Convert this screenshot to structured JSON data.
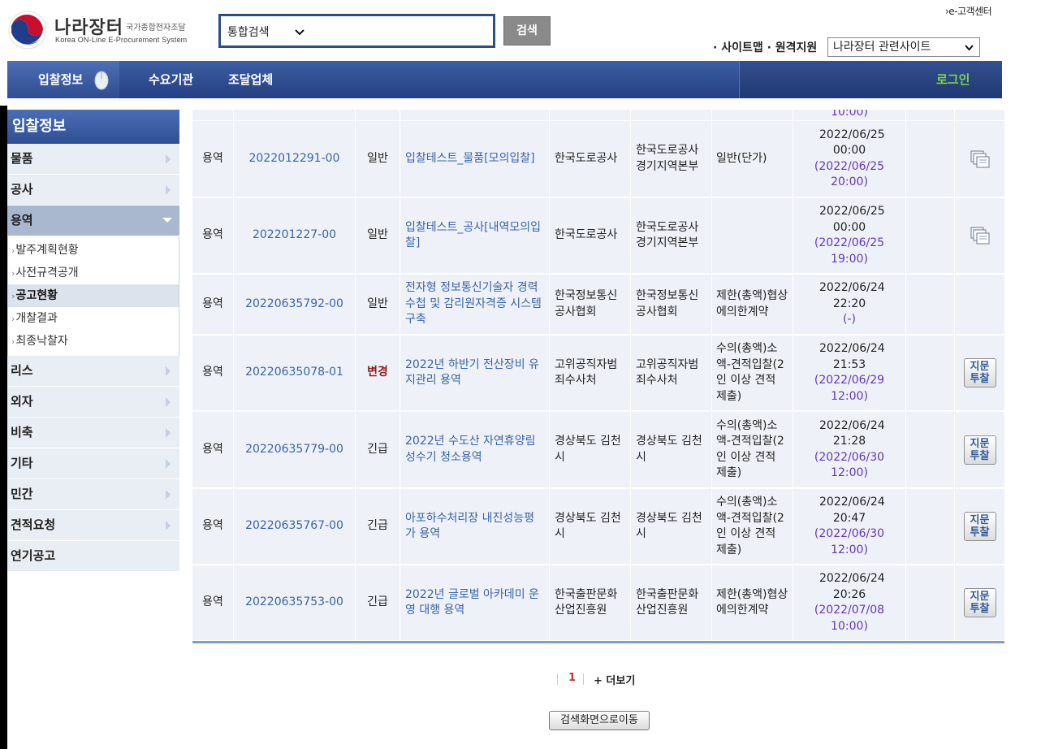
{
  "header": {
    "logo_title": "나라장터",
    "logo_subtitle": "국가종합전자조달",
    "logo_english": "Korea ON-Line E-Procurement System",
    "search_scope": "통합검색",
    "search_button": "검색",
    "customer_center": "›e-고객센터",
    "util_links": "· 사이트맵 · 원격지원",
    "related_sites": "나라장터 관련사이트"
  },
  "nav": {
    "items": [
      {
        "label": "입찰정보",
        "active": true
      },
      {
        "label": "수요기관"
      },
      {
        "label": "조달업체"
      }
    ],
    "login": "로그인"
  },
  "sidebar": {
    "title": "입찰정보",
    "items": [
      {
        "label": "물품"
      },
      {
        "label": "공사"
      },
      {
        "label": "용역",
        "open": true
      },
      {
        "label": "리스"
      },
      {
        "label": "외자"
      },
      {
        "label": "비축"
      },
      {
        "label": "기타"
      },
      {
        "label": "민간"
      },
      {
        "label": "견적요청"
      },
      {
        "label": "연기공고"
      }
    ],
    "sub_items": [
      {
        "label": "발주계획현황"
      },
      {
        "label": "사전규격공개"
      },
      {
        "label": "공고현황",
        "active": true
      },
      {
        "label": "개찰결과"
      },
      {
        "label": "최종낙찰자"
      }
    ]
  },
  "table": {
    "partial_top_text": "10:00)",
    "rows": [
      {
        "type": "용역",
        "no": "2022012291-00",
        "kind": "일반",
        "name": "입찰테스트_물품[모의입찰]",
        "org1": "한국도로공사",
        "org2": "한국도로공사 경기지역본부",
        "contract": "일반(단가)",
        "date": "2022/06/25 00:00",
        "deadline": "(2022/06/25 20:00)",
        "action": "copy"
      },
      {
        "type": "용역",
        "no": "202201227-00",
        "kind": "일반",
        "name": "입찰테스트_공사[내역모의입찰]",
        "org1": "한국도로공사",
        "org2": "한국도로공사 경기지역본부",
        "contract": "",
        "date": "2022/06/25 00:00",
        "deadline": "(2022/06/25 19:00)",
        "action": "copy"
      },
      {
        "type": "용역",
        "no": "20220635792-00",
        "kind": "일반",
        "name": "전자형 정보통신기술자 경력수첩 및 감리원자격증 시스템 구축",
        "org1": "한국정보통신공사협회",
        "org2": "한국정보통신공사협회",
        "contract": "제한(총액)협상에의한계약",
        "date": "2022/06/24 22:20",
        "deadline": "(-)",
        "action": "none"
      },
      {
        "type": "용역",
        "no": "20220635078-01",
        "kind": "변경",
        "name": "2022년 하반기 전산장비 유지관리 용역",
        "org1": "고위공직자범죄수사처",
        "org2": "고위공직자범죄수사처",
        "contract": "수의(총액)소액-견적입찰(2인 이상 견적 제출)",
        "date": "2022/06/24 21:53",
        "deadline": "(2022/06/29 12:00)",
        "action": "bid"
      },
      {
        "type": "용역",
        "no": "20220635779-00",
        "kind": "긴급",
        "name": "2022년 수도산 자연휴양림 성수기 청소용역",
        "org1": "경상북도 김천시",
        "org2": "경상북도 김천시",
        "contract": "수의(총액)소액-견적입찰(2인 이상 견적 제출)",
        "date": "2022/06/24 21:28",
        "deadline": "(2022/06/30 12:00)",
        "action": "bid"
      },
      {
        "type": "용역",
        "no": "20220635767-00",
        "kind": "긴급",
        "name": "아포하수처리장 내진성능평가 용역",
        "org1": "경상북도 김천시",
        "org2": "경상북도 김천시",
        "contract": "수의(총액)소액-견적입찰(2인 이상 견적 제출)",
        "date": "2022/06/24 20:47",
        "deadline": "(2022/06/30 12:00)",
        "action": "bid"
      },
      {
        "type": "용역",
        "no": "20220635753-00",
        "kind": "긴급",
        "name": "2022년 글로벌 아카데미 운영 대행 용역",
        "org1": "한국출판문화산업진흥원",
        "org2": "한국출판문화산업진흥원",
        "contract": "제한(총액)협상에의한계약",
        "date": "2022/06/24 20:26",
        "deadline": "(2022/07/08 10:00)",
        "action": "bid"
      }
    ],
    "bid_button": "지문투찰"
  },
  "pager": {
    "current": "1",
    "more": "+ 더보기",
    "back": "검색화면으로이동"
  }
}
